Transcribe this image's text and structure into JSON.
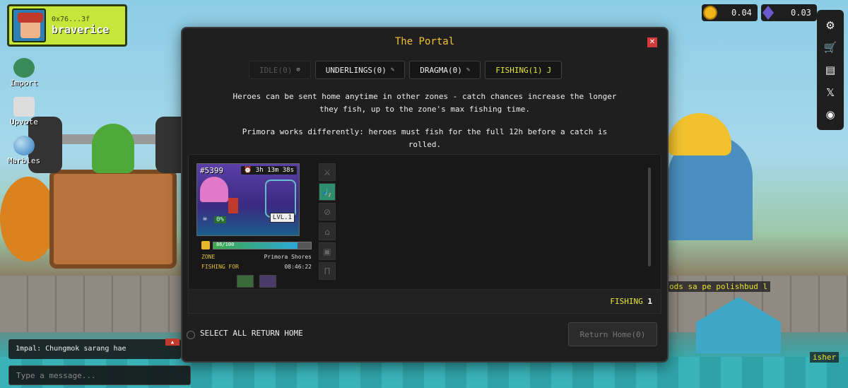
{
  "profile": {
    "address": "0x76...3f",
    "username": "braverice"
  },
  "sidebar": [
    {
      "label": "Import",
      "icon": "import-icon"
    },
    {
      "label": "Upvote",
      "icon": "upvote-icon"
    },
    {
      "label": "Marbles",
      "icon": "marbles-icon"
    }
  ],
  "currency": {
    "coins": "0.04",
    "gems": "0.03"
  },
  "right_menu": [
    "gear-icon",
    "cart-icon",
    "document-icon",
    "x-icon",
    "discord-icon"
  ],
  "modal": {
    "title": "The Portal",
    "close": "✕",
    "tabs": [
      {
        "label": "IDLE(0)",
        "icon": "⊘"
      },
      {
        "label": "UNDERLINGS(0)",
        "icon": "✎"
      },
      {
        "label": "DRAGMA(0)",
        "icon": "✎"
      },
      {
        "label": "FISHING(1)",
        "icon": "J"
      }
    ],
    "description_1": "Heroes can be sent home anytime in other zones - catch chances increase the longer they fish, up to the zone's max fishing time.",
    "description_2": "Primora works differently: heroes must fish for the full 12h before a catch is rolled.",
    "hero": {
      "id": "#5399",
      "timer": "⏰ 3h 13m 38s",
      "percent": "0%",
      "level": "LVL.1",
      "energy": "86/100",
      "energy_fraction": 0.86,
      "zone_label": "ZONE",
      "zone_value": "Primora Shores",
      "fishing_for_label": "FISHING FOR",
      "fishing_for_value": "08:46:22"
    },
    "status_label": "FISHING",
    "status_count": "1",
    "select_all_label": "SELECT ALL RETURN HOME",
    "return_button": "Return Home(0)"
  },
  "chat": {
    "message": "1mpal: Chungmok sarang hae",
    "placeholder": "Type a message..."
  },
  "world": {
    "nameplate_1": "ods sa pe polishbud l",
    "nameplate_2": "isher"
  }
}
